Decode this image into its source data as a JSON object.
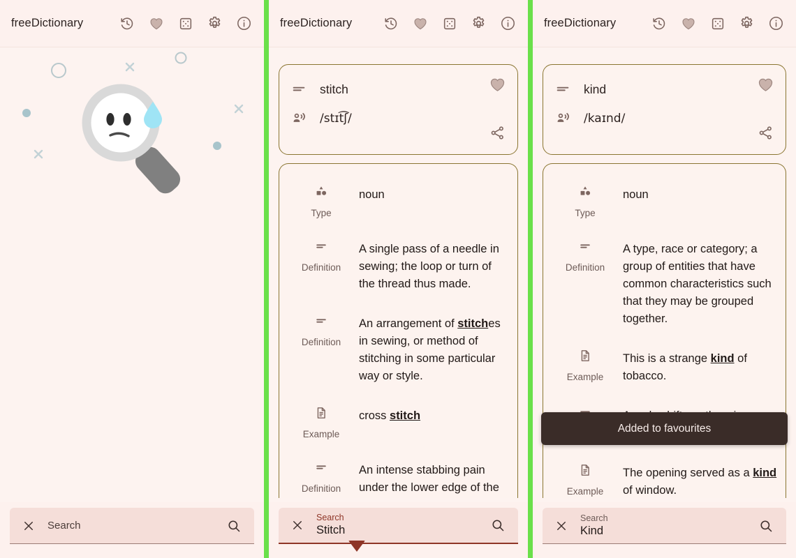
{
  "app": {
    "title": "freeDictionary",
    "accent_green_divider": "#6ae04a",
    "background": "#fdf1ee",
    "card_border": "#8a7531",
    "icon_color": "#7d6660",
    "snackbar_bg": "#3a2c28"
  },
  "appbar_icons": [
    {
      "name": "history-icon",
      "label": "History"
    },
    {
      "name": "favourites-heart-icon",
      "label": "Favourites"
    },
    {
      "name": "random-dice-icon",
      "label": "Random word"
    },
    {
      "name": "settings-gear-icon",
      "label": "Settings"
    },
    {
      "name": "info-icon",
      "label": "About"
    }
  ],
  "panels": [
    {
      "id": "left",
      "state": "empty",
      "illustration": "sad-magnifier-face",
      "search": {
        "placeholder": "Search",
        "value": "",
        "focused": false,
        "clear_icon": "close-icon",
        "submit_icon": "search-icon"
      }
    },
    {
      "id": "middle",
      "state": "result",
      "word": {
        "term": "stitch",
        "ipa": "/stɪt͡ʃ/",
        "term_icon": "definition-lines-icon",
        "audio_icon": "pronounce-speaker-icon",
        "favourite_icon": "heart-icon",
        "share_icon": "share-icon"
      },
      "entries": [
        {
          "label": "Type",
          "icon": "category-shapes-icon",
          "text": "noun"
        },
        {
          "label": "Definition",
          "icon": "definition-lines-icon",
          "text": "A single pass of a needle in sewing; the loop or turn of the thread thus made."
        },
        {
          "label": "Definition",
          "icon": "definition-lines-icon",
          "html": "An arrangement of <b>stitch</b>es in sewing, or method of stitching in some particular way or style."
        },
        {
          "label": "Example",
          "icon": "example-document-icon",
          "html": "cross <b>stitch</b>"
        },
        {
          "label": "Definition",
          "icon": "definition-lines-icon",
          "text": "An intense stabbing pain under the lower edge of the ribcage, brought on by exercise."
        }
      ],
      "search": {
        "placeholder": "Search",
        "label": "Search",
        "value": "Stitch",
        "focused": true,
        "clear_icon": "close-icon",
        "submit_icon": "search-icon"
      }
    },
    {
      "id": "right",
      "state": "result",
      "word": {
        "term": "kind",
        "ipa": "/kaɪnd/",
        "term_icon": "definition-lines-icon",
        "audio_icon": "pronounce-speaker-icon",
        "favourite_icon": "heart-icon",
        "share_icon": "share-icon"
      },
      "entries": [
        {
          "label": "Type",
          "icon": "category-shapes-icon",
          "text": "noun"
        },
        {
          "label": "Definition",
          "icon": "definition-lines-icon",
          "text": "A type, race or category; a group of entities that have common characteristics such that they may be grouped together."
        },
        {
          "label": "Example",
          "icon": "example-document-icon",
          "html": "This is a strange <b>kind</b> of tobacco."
        },
        {
          "label": "Definition",
          "icon": "definition-lines-icon",
          "text": "A makeshift or otherwise atypical specimen."
        },
        {
          "label": "Example",
          "icon": "example-document-icon",
          "html": "The opening served as a <b>kind</b> of window."
        }
      ],
      "snackbar": {
        "message": "Added to favourites"
      },
      "search": {
        "placeholder": "Search",
        "label": "Search",
        "value": "Kind",
        "focused": false,
        "clear_icon": "close-icon",
        "submit_icon": "search-icon"
      }
    }
  ]
}
